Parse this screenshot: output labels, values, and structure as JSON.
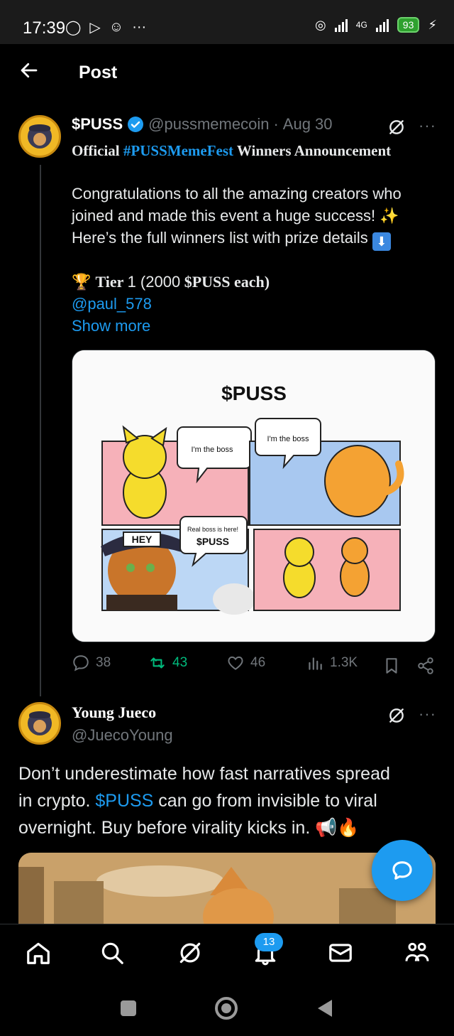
{
  "status_bar": {
    "time": "17:39",
    "network": "4G",
    "battery": "93"
  },
  "header": {
    "title": "Post"
  },
  "post1": {
    "name": "$PUSS",
    "handle": "@pussmemecoin",
    "separator": "·",
    "date": "Aug 30",
    "line1_prefix": "Official ",
    "line1_hashtag": "#PUSSMemeFest",
    "line1_suffix": " Winners Announcement",
    "para1": "Congratulations to all the amazing creators who joined and made this event a huge success! ✨",
    "para2_text": "Here’s the full winners list with prize details",
    "tier_line_a": "Tier ",
    "tier_num": "1 (2000",
    "tier_line_b": " $PUSS each)",
    "mention": "@paul_578",
    "show_more": "Show more",
    "image": {
      "title": "$PUSS",
      "bubble1": "I'm the boss",
      "bubble2": "I'm the boss",
      "hey": "HEY",
      "bubble3a": "Real boss is here!",
      "bubble3b": "$PUSS"
    },
    "stats": {
      "replies": "38",
      "reposts": "43",
      "likes": "46",
      "views": "1.3K"
    },
    "colors": {
      "repost_green": "#00ba7c",
      "link_blue": "#1d9bf0"
    }
  },
  "post2": {
    "name": "Young Jueco",
    "handle": "@JuecoYoung",
    "line1": "Don’t underestimate how fast narratives spread",
    "line2_a": "in crypto. ",
    "line2_link": "$PUSS",
    "line2_b": " can go from invisible to viral",
    "line3": "overnight. Buy before virality kicks in. 📢🔥"
  },
  "bottom_nav": {
    "notifications_badge": "13"
  },
  "icons": [
    "back-arrow-icon",
    "verified-icon",
    "grok-icon",
    "more-icon",
    "reply-icon",
    "repost-icon",
    "like-icon",
    "views-icon",
    "bookmark-icon",
    "share-icon",
    "compose-icon",
    "home-icon",
    "search-icon",
    "notifications-icon",
    "messages-icon",
    "communities-icon"
  ]
}
